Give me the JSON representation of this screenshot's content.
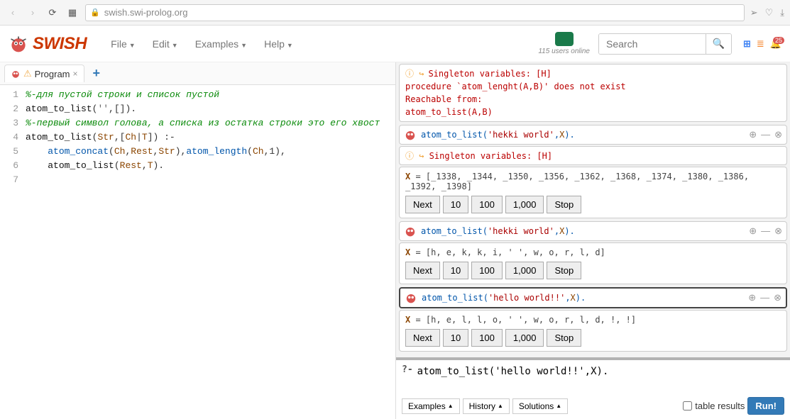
{
  "browser": {
    "url": "swish.swi-prolog.org"
  },
  "brand": "SWISH",
  "menus": [
    "File",
    "Edit",
    "Examples",
    "Help"
  ],
  "users_online": "115 users online",
  "search_placeholder": "Search",
  "notification_count": "25",
  "tab": {
    "label": "Program"
  },
  "code_lines": [
    {
      "n": 1,
      "spans": [
        {
          "c": "c-comment",
          "t": "%-для пустой строки и список пустой"
        }
      ]
    },
    {
      "n": 2,
      "spans": [
        {
          "c": "c-atom",
          "t": "atom_to_list"
        },
        {
          "c": "c-punct",
          "t": "("
        },
        {
          "c": "c-string",
          "t": "''"
        },
        {
          "c": "c-punct",
          "t": ",[])."
        }
      ]
    },
    {
      "n": 3,
      "spans": [
        {
          "c": "c-comment",
          "t": "%-первый символ голова, а списка из остатка строки это его хвост"
        }
      ]
    },
    {
      "n": 4,
      "spans": [
        {
          "c": "c-atom",
          "t": "atom_to_list"
        },
        {
          "c": "c-punct",
          "t": "("
        },
        {
          "c": "c-var",
          "t": "Str"
        },
        {
          "c": "c-punct",
          "t": ",["
        },
        {
          "c": "c-var",
          "t": "Ch"
        },
        {
          "c": "c-punct",
          "t": "|"
        },
        {
          "c": "c-var",
          "t": "T"
        },
        {
          "c": "c-punct",
          "t": "]) :-"
        }
      ]
    },
    {
      "n": 5,
      "spans": [
        {
          "c": "",
          "t": "    "
        },
        {
          "c": "c-builtin",
          "t": "atom_concat"
        },
        {
          "c": "c-punct",
          "t": "("
        },
        {
          "c": "c-var",
          "t": "Ch"
        },
        {
          "c": "c-punct",
          "t": ","
        },
        {
          "c": "c-var",
          "t": "Rest"
        },
        {
          "c": "c-punct",
          "t": ","
        },
        {
          "c": "c-var",
          "t": "Str"
        },
        {
          "c": "c-punct",
          "t": "),"
        },
        {
          "c": "c-builtin",
          "t": "atom_length"
        },
        {
          "c": "c-punct",
          "t": "("
        },
        {
          "c": "c-var",
          "t": "Ch"
        },
        {
          "c": "c-punct",
          "t": ",1),"
        }
      ]
    },
    {
      "n": 6,
      "spans": [
        {
          "c": "",
          "t": "    "
        },
        {
          "c": "c-atom",
          "t": "atom_to_list"
        },
        {
          "c": "c-punct",
          "t": "("
        },
        {
          "c": "c-var",
          "t": "Rest"
        },
        {
          "c": "c-punct",
          "t": ","
        },
        {
          "c": "c-var",
          "t": "T"
        },
        {
          "c": "c-punct",
          "t": ")."
        }
      ]
    },
    {
      "n": 7,
      "spans": [
        {
          "c": "",
          "t": ""
        }
      ]
    }
  ],
  "err1": {
    "line1_icon": "ⓘ ↪",
    "line1": "Singleton variables: [H]",
    "line2": "procedure `atom_lenght(A,B)' does not exist",
    "line3": "Reachable from:",
    "line4": "          atom_to_list(A,B)"
  },
  "queries": [
    {
      "call": "atom_to_list",
      "arg_str": "'hekki world'",
      "arg_var": "X",
      "warn_icon": "ⓘ ↪",
      "warn": "Singleton variables: [H]",
      "binding_var": "X",
      "binding": " = [_1338, _1344, _1350, _1356, _1362, _1368, _1374, _1380, _1386, _1392, _1398]",
      "selected": false
    },
    {
      "call": "atom_to_list",
      "arg_str": "'hekki world'",
      "arg_var": "X",
      "binding_var": "X",
      "binding": " = [h, e, k, k, i, ' ', w, o, r, l, d]",
      "selected": false
    },
    {
      "call": "atom_to_list",
      "arg_str": "'hello world!!'",
      "arg_var": "X",
      "binding_var": "X",
      "binding": " = [h, e, l, l, o, ' ', w, o, r, l, d, !, !]",
      "selected": true
    }
  ],
  "btns": {
    "next": "Next",
    "n10": "10",
    "n100": "100",
    "n1000": "1,000",
    "stop": "Stop"
  },
  "query_input": "atom_to_list('hello world!!',X).",
  "query_prompt": "?-",
  "qi_buttons": {
    "examples": "Examples",
    "history": "History",
    "solutions": "Solutions"
  },
  "table_results": "table results",
  "run": "Run!"
}
